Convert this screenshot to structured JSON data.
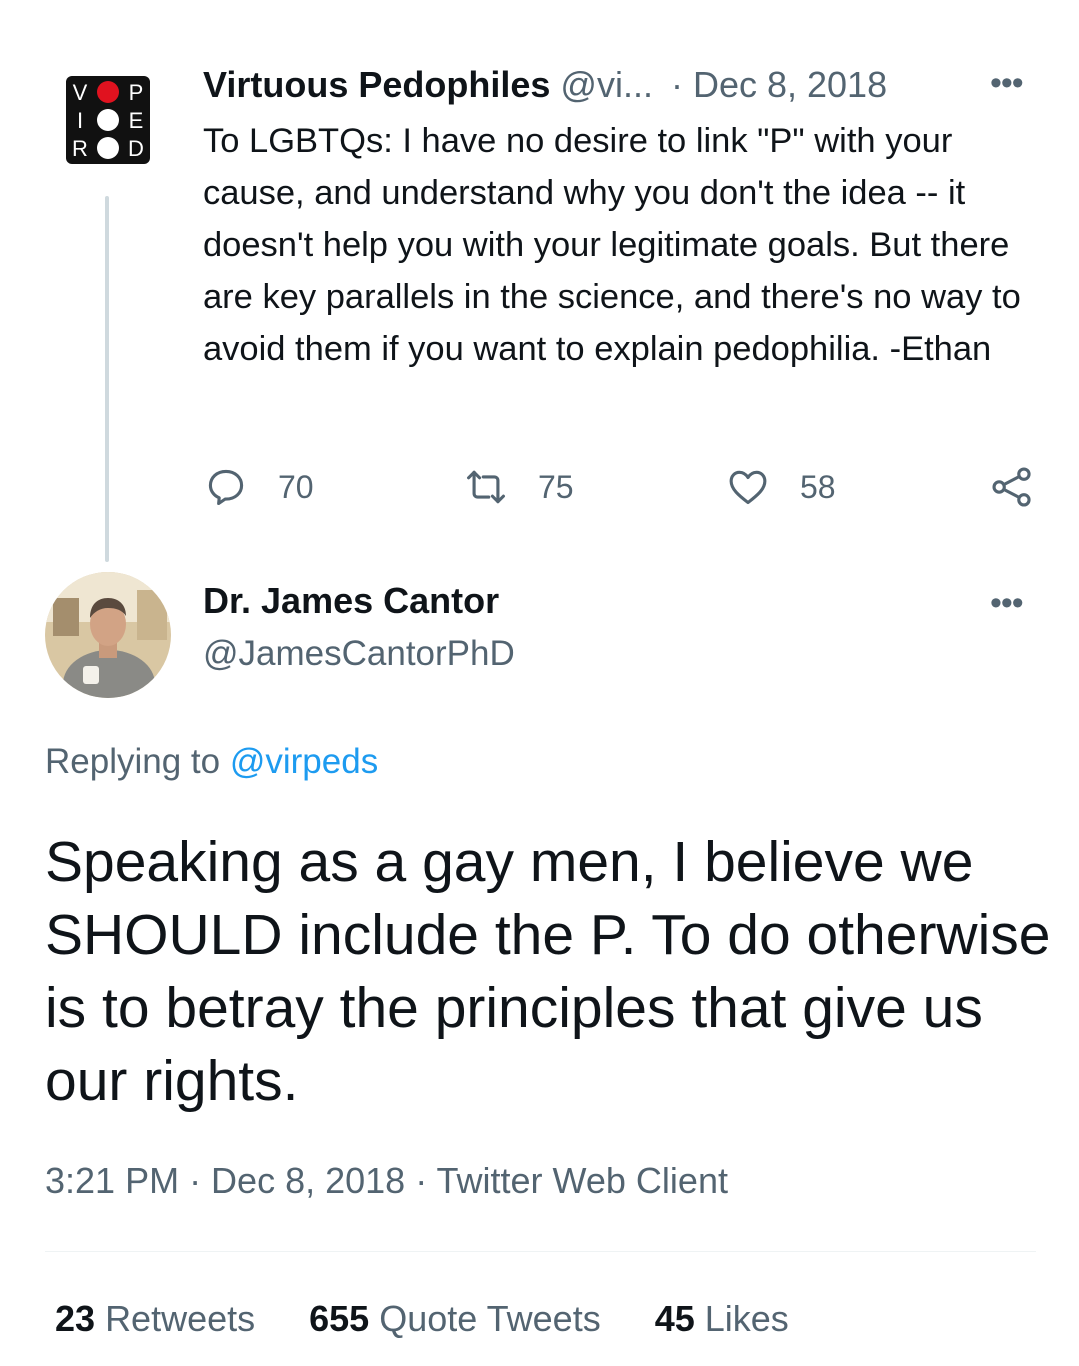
{
  "parent_tweet": {
    "author_name": "Virtuous Pedophiles",
    "author_handle": "@vi...",
    "separator": "·",
    "date": "Dec 8, 2018",
    "more": "•••",
    "logo_letters": [
      "V",
      "P",
      "I",
      "E",
      "R",
      "D"
    ],
    "text": "To LGBTQs: I have no desire to link \"P\" with your cause, and understand why you don't the idea -- it doesn't help you with your legitimate goals. But there are key parallels in the science, and there's no way to avoid them if you want to explain pedophilia.  -Ethan",
    "actions": {
      "replies": "70",
      "retweets": "75",
      "likes": "58"
    }
  },
  "main_tweet": {
    "author_name": "Dr. James Cantor",
    "author_handle": "@JamesCantorPhD",
    "more": "•••",
    "replying_prefix": "Replying to",
    "replying_handle": "@virpeds",
    "text": "Speaking as a gay men, I believe we SHOULD include the P.  To do otherwise is to betray the principles that give us our rights.",
    "meta": "3:21 PM · Dec 8, 2018 · Twitter Web Client",
    "stats": [
      {
        "count": "23",
        "label": "Retweets"
      },
      {
        "count": "655",
        "label": "Quote Tweets"
      },
      {
        "count": "45",
        "label": "Likes"
      }
    ]
  },
  "colors": {
    "text": "#0f1419",
    "secondary": "#536471",
    "link": "#1d9bf0",
    "logo_red": "#e0121f"
  }
}
